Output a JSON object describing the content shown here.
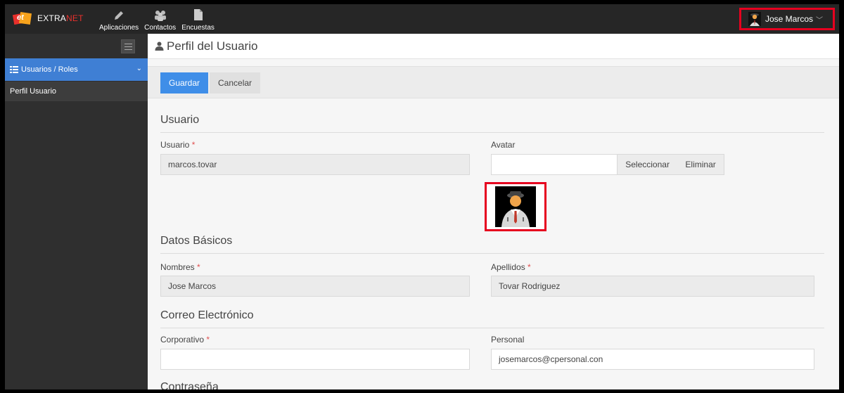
{
  "topbar": {
    "logo": {
      "badge": "et",
      "text_primary": "EXTRA",
      "text_accent": "NET"
    },
    "nav": [
      {
        "label": "Aplicaciones",
        "icon": "pencil-icon"
      },
      {
        "label": "Contactos",
        "icon": "users-icon"
      },
      {
        "label": "Encuestas",
        "icon": "document-icon"
      }
    ],
    "user": {
      "name": "Jose Marcos",
      "chevron": "﹀"
    }
  },
  "sidebar": {
    "active_item": {
      "label": "Usuarios / Roles",
      "icon": "list-icon",
      "chevron": "⌄"
    },
    "sub_items": [
      {
        "label": "Perfil Usuario"
      }
    ]
  },
  "page": {
    "title": "Perfil del Usuario",
    "icon": "user-icon"
  },
  "toolbar": {
    "save_label": "Guardar",
    "cancel_label": "Cancelar"
  },
  "sections": {
    "usuario": {
      "title": "Usuario",
      "username_label": "Usuario",
      "username_value": "marcos.tovar",
      "avatar_label": "Avatar",
      "avatar_select": "Seleccionar",
      "avatar_delete": "Eliminar"
    },
    "datos_basicos": {
      "title": "Datos Básicos",
      "nombres_label": "Nombres",
      "nombres_value": "Jose Marcos",
      "apellidos_label": "Apellidos",
      "apellidos_value": "Tovar Rodriguez"
    },
    "correo": {
      "title": "Correo Electrónico",
      "corporativo_label": "Corporativo",
      "corporativo_value": "",
      "personal_label": "Personal",
      "personal_value": "josemarcos@cpersonal.con"
    },
    "contrasena": {
      "title": "Contraseña"
    }
  },
  "required_marker": "*",
  "colors": {
    "accent": "#3f8ee8",
    "highlight": "#e6001f",
    "topbar": "#262626",
    "sidebar": "#2f2f2f"
  }
}
